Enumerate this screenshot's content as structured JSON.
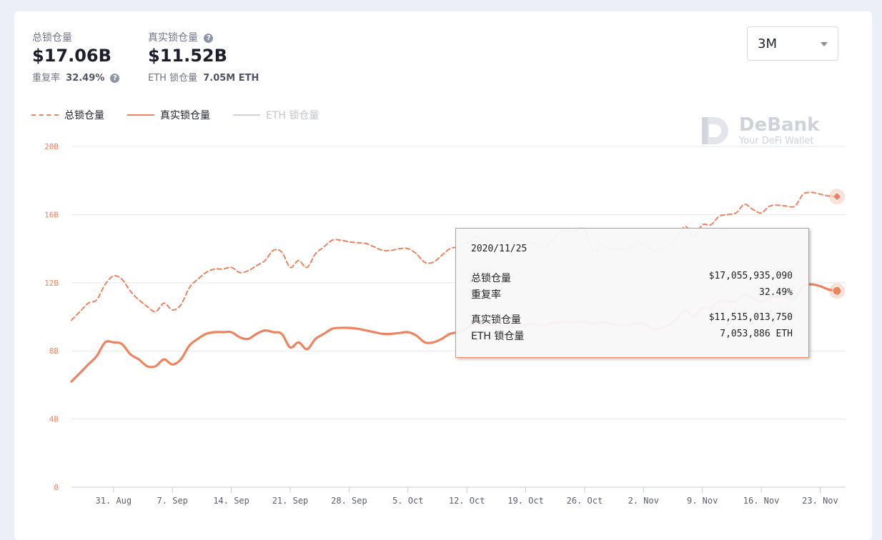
{
  "stats": {
    "total_label": "总锁仓量",
    "total_value": "$17.06B",
    "dup_label": "重复率",
    "dup_value": "32.49%",
    "real_label": "真实锁仓量",
    "real_value": "$11.52B",
    "eth_label": "ETH 锁仓量",
    "eth_value": "7.05M ETH"
  },
  "range_select": {
    "value": "3M"
  },
  "legend": [
    {
      "label": "总锁仓量",
      "style": "dashed",
      "color": "#f0835f",
      "active": true
    },
    {
      "label": "真实锁仓量",
      "style": "solid",
      "color": "#f0835f",
      "active": true
    },
    {
      "label": "ETH 锁仓量",
      "style": "solid",
      "color": "#cfd2da",
      "active": false
    }
  ],
  "watermark": {
    "title": "DeBank",
    "subtitle": "Your DeFi Wallet"
  },
  "tooltip": {
    "date": "2020/11/25",
    "rows": [
      {
        "key": "总锁仓量",
        "value": "$17,055,935,090"
      },
      {
        "key": "重复率",
        "value": "32.49%"
      },
      {
        "key": "真实锁仓量",
        "value": "$11,515,013,750"
      },
      {
        "key": "ETH 锁仓量",
        "value": "7,053,886 ETH"
      }
    ]
  },
  "chart_data": {
    "type": "line",
    "x_range": [
      "2020-08-26",
      "2020-11-25"
    ],
    "ylim": [
      0,
      20
    ],
    "y_ticks": [
      "0",
      "4B",
      "8B",
      "12B",
      "16B",
      "20B"
    ],
    "x_ticks": [
      {
        "label": "31. Aug",
        "date": "2020-08-31"
      },
      {
        "label": "7. Sep",
        "date": "2020-09-07"
      },
      {
        "label": "14. Sep",
        "date": "2020-09-14"
      },
      {
        "label": "21. Sep",
        "date": "2020-09-21"
      },
      {
        "label": "28. Sep",
        "date": "2020-09-28"
      },
      {
        "label": "5. Oct",
        "date": "2020-10-05"
      },
      {
        "label": "12. Oct",
        "date": "2020-10-12"
      },
      {
        "label": "19. Oct",
        "date": "2020-10-19"
      },
      {
        "label": "26. Oct",
        "date": "2020-10-26"
      },
      {
        "label": "2. Nov",
        "date": "2020-11-02"
      },
      {
        "label": "9. Nov",
        "date": "2020-11-09"
      },
      {
        "label": "16. Nov",
        "date": "2020-11-16"
      },
      {
        "label": "23. Nov",
        "date": "2020-11-23"
      }
    ],
    "grid": true,
    "series": [
      {
        "name": "总锁仓量",
        "style": "dashed",
        "color": "#f0835f",
        "points": [
          [
            "2020-08-26",
            9.8
          ],
          [
            "2020-08-27",
            10.3
          ],
          [
            "2020-08-28",
            10.8
          ],
          [
            "2020-08-29",
            11.0
          ],
          [
            "2020-08-30",
            11.9
          ],
          [
            "2020-08-31",
            12.4
          ],
          [
            "2020-09-01",
            12.2
          ],
          [
            "2020-09-02",
            11.5
          ],
          [
            "2020-09-03",
            11.0
          ],
          [
            "2020-09-04",
            10.6
          ],
          [
            "2020-09-05",
            10.3
          ],
          [
            "2020-09-06",
            10.8
          ],
          [
            "2020-09-07",
            10.4
          ],
          [
            "2020-09-08",
            10.7
          ],
          [
            "2020-09-09",
            11.7
          ],
          [
            "2020-09-10",
            12.2
          ],
          [
            "2020-09-11",
            12.6
          ],
          [
            "2020-09-12",
            12.8
          ],
          [
            "2020-09-13",
            12.8
          ],
          [
            "2020-09-14",
            12.9
          ],
          [
            "2020-09-15",
            12.6
          ],
          [
            "2020-09-16",
            12.7
          ],
          [
            "2020-09-17",
            13.0
          ],
          [
            "2020-09-18",
            13.3
          ],
          [
            "2020-09-19",
            13.9
          ],
          [
            "2020-09-20",
            13.8
          ],
          [
            "2020-09-21",
            12.9
          ],
          [
            "2020-09-22",
            13.3
          ],
          [
            "2020-09-23",
            12.9
          ],
          [
            "2020-09-24",
            13.7
          ],
          [
            "2020-09-25",
            14.1
          ],
          [
            "2020-09-26",
            14.5
          ],
          [
            "2020-09-27",
            14.5
          ],
          [
            "2020-09-28",
            14.4
          ],
          [
            "2020-09-29",
            14.35
          ],
          [
            "2020-09-30",
            14.3
          ],
          [
            "2020-10-01",
            14.1
          ],
          [
            "2020-10-02",
            13.9
          ],
          [
            "2020-10-03",
            13.9
          ],
          [
            "2020-10-04",
            14.0
          ],
          [
            "2020-10-05",
            14.0
          ],
          [
            "2020-10-06",
            13.7
          ],
          [
            "2020-10-07",
            13.2
          ],
          [
            "2020-10-08",
            13.2
          ],
          [
            "2020-10-09",
            13.6
          ],
          [
            "2020-10-10",
            14.0
          ],
          [
            "2020-10-11",
            14.1
          ],
          [
            "2020-10-12",
            14.3
          ],
          [
            "2020-10-13",
            14.7
          ],
          [
            "2020-10-14",
            14.5
          ],
          [
            "2020-10-15",
            14.5
          ],
          [
            "2020-10-16",
            14.4
          ],
          [
            "2020-10-17",
            14.2
          ],
          [
            "2020-10-18",
            14.0
          ],
          [
            "2020-10-19",
            14.2
          ],
          [
            "2020-10-20",
            14.3
          ],
          [
            "2020-10-21",
            14.1
          ],
          [
            "2020-10-22",
            14.4
          ],
          [
            "2020-10-23",
            15.0
          ],
          [
            "2020-10-24",
            15.0
          ],
          [
            "2020-10-25",
            15.1
          ],
          [
            "2020-10-26",
            15.1
          ],
          [
            "2020-10-27",
            13.9
          ],
          [
            "2020-10-28",
            14.2
          ],
          [
            "2020-10-29",
            14.0
          ],
          [
            "2020-10-30",
            13.95
          ],
          [
            "2020-10-31",
            14.0
          ],
          [
            "2020-11-01",
            14.2
          ],
          [
            "2020-11-02",
            14.3
          ],
          [
            "2020-11-03",
            13.9
          ],
          [
            "2020-11-04",
            14.0
          ],
          [
            "2020-11-05",
            14.2
          ],
          [
            "2020-11-06",
            14.7
          ],
          [
            "2020-11-07",
            15.3
          ],
          [
            "2020-11-08",
            14.7
          ],
          [
            "2020-11-09",
            15.4
          ],
          [
            "2020-11-10",
            15.4
          ],
          [
            "2020-11-11",
            15.9
          ],
          [
            "2020-11-12",
            16.0
          ],
          [
            "2020-11-13",
            16.1
          ],
          [
            "2020-11-14",
            16.6
          ],
          [
            "2020-11-15",
            16.3
          ],
          [
            "2020-11-16",
            16.1
          ],
          [
            "2020-11-17",
            16.5
          ],
          [
            "2020-11-18",
            16.55
          ],
          [
            "2020-11-19",
            16.5
          ],
          [
            "2020-11-20",
            16.5
          ],
          [
            "2020-11-21",
            17.2
          ],
          [
            "2020-11-22",
            17.3
          ],
          [
            "2020-11-23",
            17.2
          ],
          [
            "2020-11-24",
            17.1
          ],
          [
            "2020-11-25",
            17.06
          ]
        ]
      },
      {
        "name": "真实锁仓量",
        "style": "solid",
        "color": "#f0835f",
        "points": [
          [
            "2020-08-26",
            6.2
          ],
          [
            "2020-08-27",
            6.7
          ],
          [
            "2020-08-28",
            7.2
          ],
          [
            "2020-08-29",
            7.7
          ],
          [
            "2020-08-30",
            8.5
          ],
          [
            "2020-08-31",
            8.5
          ],
          [
            "2020-09-01",
            8.4
          ],
          [
            "2020-09-02",
            7.8
          ],
          [
            "2020-09-03",
            7.5
          ],
          [
            "2020-09-04",
            7.1
          ],
          [
            "2020-09-05",
            7.1
          ],
          [
            "2020-09-06",
            7.5
          ],
          [
            "2020-09-07",
            7.2
          ],
          [
            "2020-09-08",
            7.5
          ],
          [
            "2020-09-09",
            8.3
          ],
          [
            "2020-09-10",
            8.7
          ],
          [
            "2020-09-11",
            9.0
          ],
          [
            "2020-09-12",
            9.1
          ],
          [
            "2020-09-13",
            9.1
          ],
          [
            "2020-09-14",
            9.1
          ],
          [
            "2020-09-15",
            8.8
          ],
          [
            "2020-09-16",
            8.7
          ],
          [
            "2020-09-17",
            9.0
          ],
          [
            "2020-09-18",
            9.2
          ],
          [
            "2020-09-19",
            9.1
          ],
          [
            "2020-09-20",
            9.0
          ],
          [
            "2020-09-21",
            8.2
          ],
          [
            "2020-09-22",
            8.5
          ],
          [
            "2020-09-23",
            8.1
          ],
          [
            "2020-09-24",
            8.7
          ],
          [
            "2020-09-25",
            9.0
          ],
          [
            "2020-09-26",
            9.3
          ],
          [
            "2020-09-27",
            9.35
          ],
          [
            "2020-09-28",
            9.35
          ],
          [
            "2020-09-29",
            9.3
          ],
          [
            "2020-09-30",
            9.2
          ],
          [
            "2020-10-01",
            9.1
          ],
          [
            "2020-10-02",
            9.0
          ],
          [
            "2020-10-03",
            9.0
          ],
          [
            "2020-10-04",
            9.05
          ],
          [
            "2020-10-05",
            9.1
          ],
          [
            "2020-10-06",
            8.9
          ],
          [
            "2020-10-07",
            8.5
          ],
          [
            "2020-10-08",
            8.5
          ],
          [
            "2020-10-09",
            8.7
          ],
          [
            "2020-10-10",
            9.0
          ],
          [
            "2020-10-11",
            9.1
          ],
          [
            "2020-10-12",
            9.3
          ],
          [
            "2020-10-13",
            9.6
          ],
          [
            "2020-10-14",
            9.5
          ],
          [
            "2020-10-15",
            9.5
          ],
          [
            "2020-10-16",
            9.45
          ],
          [
            "2020-10-17",
            9.4
          ],
          [
            "2020-10-18",
            9.4
          ],
          [
            "2020-10-19",
            9.5
          ],
          [
            "2020-10-20",
            9.6
          ],
          [
            "2020-10-21",
            9.5
          ],
          [
            "2020-10-22",
            9.6
          ],
          [
            "2020-10-23",
            9.7
          ],
          [
            "2020-10-24",
            9.7
          ],
          [
            "2020-10-25",
            9.7
          ],
          [
            "2020-10-26",
            9.7
          ],
          [
            "2020-10-27",
            9.6
          ],
          [
            "2020-10-28",
            9.7
          ],
          [
            "2020-10-29",
            9.6
          ],
          [
            "2020-10-30",
            9.5
          ],
          [
            "2020-10-31",
            9.5
          ],
          [
            "2020-11-01",
            9.6
          ],
          [
            "2020-11-02",
            9.6
          ],
          [
            "2020-11-03",
            9.3
          ],
          [
            "2020-11-04",
            9.3
          ],
          [
            "2020-11-05",
            9.5
          ],
          [
            "2020-11-06",
            9.9
          ],
          [
            "2020-11-07",
            10.4
          ],
          [
            "2020-11-08",
            10.0
          ],
          [
            "2020-11-09",
            10.5
          ],
          [
            "2020-11-10",
            10.5
          ],
          [
            "2020-11-11",
            10.9
          ],
          [
            "2020-11-12",
            10.9
          ],
          [
            "2020-11-13",
            10.9
          ],
          [
            "2020-11-14",
            11.3
          ],
          [
            "2020-11-15",
            11.1
          ],
          [
            "2020-11-16",
            10.9
          ],
          [
            "2020-11-17",
            11.1
          ],
          [
            "2020-11-18",
            11.2
          ],
          [
            "2020-11-19",
            11.1
          ],
          [
            "2020-11-20",
            11.1
          ],
          [
            "2020-11-21",
            11.8
          ],
          [
            "2020-11-22",
            11.9
          ],
          [
            "2020-11-23",
            11.8
          ],
          [
            "2020-11-24",
            11.6
          ],
          [
            "2020-11-25",
            11.52
          ]
        ]
      }
    ]
  }
}
